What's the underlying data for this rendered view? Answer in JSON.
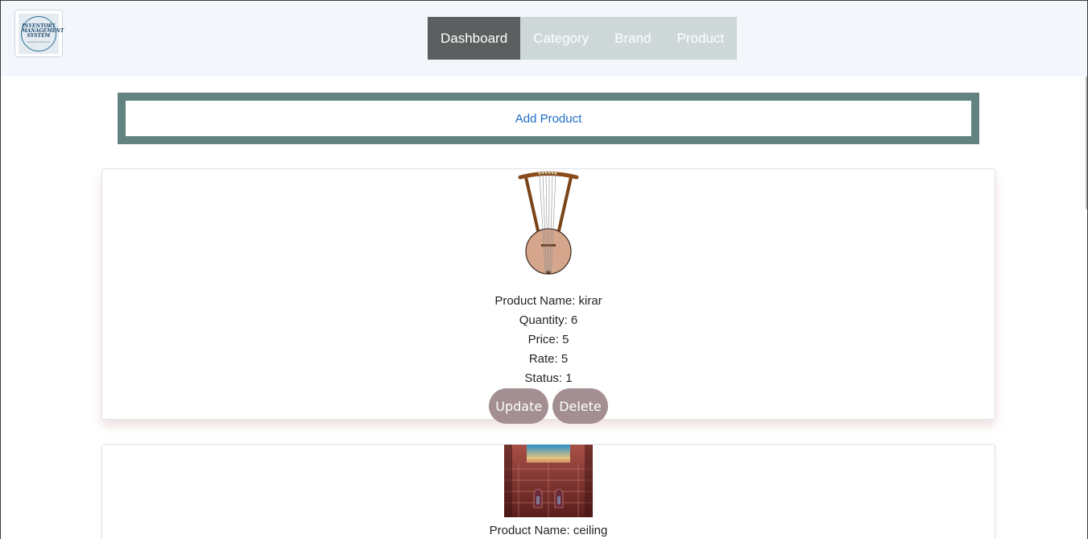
{
  "logo": {
    "line1": "INVENTORY",
    "line2": "MANAGEMENT",
    "line3": "SYSTEM",
    "tagline": "Simple & Efficient"
  },
  "nav": {
    "tabs": [
      {
        "label": "Dashboard",
        "active": true
      },
      {
        "label": "Category",
        "active": false
      },
      {
        "label": "Brand",
        "active": false
      },
      {
        "label": "Product",
        "active": false
      }
    ]
  },
  "add_product": {
    "label": "Add Product"
  },
  "products": [
    {
      "image_icon": "harp-instrument-image",
      "name_line": "Product Name: kirar",
      "quantity_line": "Quantity: 6",
      "price_line": "Price: 5",
      "rate_line": "Rate: 5",
      "status_line": "Status: 1",
      "update_label": "Update",
      "delete_label": "Delete"
    },
    {
      "image_icon": "ornate-ceiling-image",
      "name_line": "Product Name: ceiling"
    }
  ],
  "colors": {
    "nav_bg": "#f3f7fc",
    "tab_active": "#5c5f5f",
    "tab_inactive": "#cfd8d8",
    "add_box_border": "#638381",
    "link": "#1e6fc8",
    "button": "#a38f91"
  }
}
